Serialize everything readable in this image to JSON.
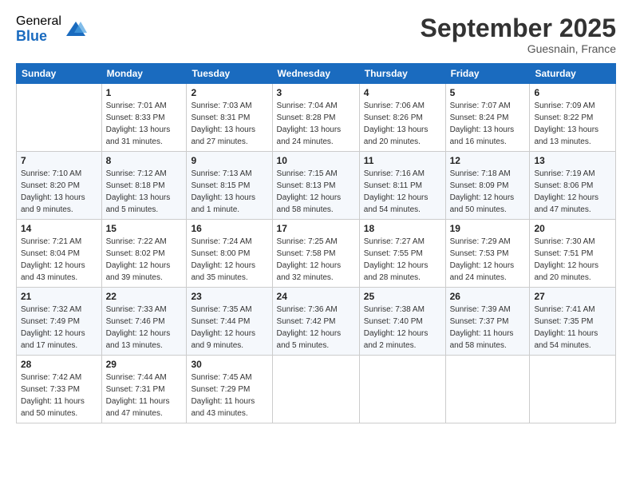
{
  "logo": {
    "general": "General",
    "blue": "Blue"
  },
  "title": "September 2025",
  "subtitle": "Guesnain, France",
  "days_header": [
    "Sunday",
    "Monday",
    "Tuesday",
    "Wednesday",
    "Thursday",
    "Friday",
    "Saturday"
  ],
  "weeks": [
    [
      {
        "day": "",
        "sunrise": "",
        "sunset": "",
        "daylight": ""
      },
      {
        "day": "1",
        "sunrise": "Sunrise: 7:01 AM",
        "sunset": "Sunset: 8:33 PM",
        "daylight": "Daylight: 13 hours and 31 minutes."
      },
      {
        "day": "2",
        "sunrise": "Sunrise: 7:03 AM",
        "sunset": "Sunset: 8:31 PM",
        "daylight": "Daylight: 13 hours and 27 minutes."
      },
      {
        "day": "3",
        "sunrise": "Sunrise: 7:04 AM",
        "sunset": "Sunset: 8:28 PM",
        "daylight": "Daylight: 13 hours and 24 minutes."
      },
      {
        "day": "4",
        "sunrise": "Sunrise: 7:06 AM",
        "sunset": "Sunset: 8:26 PM",
        "daylight": "Daylight: 13 hours and 20 minutes."
      },
      {
        "day": "5",
        "sunrise": "Sunrise: 7:07 AM",
        "sunset": "Sunset: 8:24 PM",
        "daylight": "Daylight: 13 hours and 16 minutes."
      },
      {
        "day": "6",
        "sunrise": "Sunrise: 7:09 AM",
        "sunset": "Sunset: 8:22 PM",
        "daylight": "Daylight: 13 hours and 13 minutes."
      }
    ],
    [
      {
        "day": "7",
        "sunrise": "Sunrise: 7:10 AM",
        "sunset": "Sunset: 8:20 PM",
        "daylight": "Daylight: 13 hours and 9 minutes."
      },
      {
        "day": "8",
        "sunrise": "Sunrise: 7:12 AM",
        "sunset": "Sunset: 8:18 PM",
        "daylight": "Daylight: 13 hours and 5 minutes."
      },
      {
        "day": "9",
        "sunrise": "Sunrise: 7:13 AM",
        "sunset": "Sunset: 8:15 PM",
        "daylight": "Daylight: 13 hours and 1 minute."
      },
      {
        "day": "10",
        "sunrise": "Sunrise: 7:15 AM",
        "sunset": "Sunset: 8:13 PM",
        "daylight": "Daylight: 12 hours and 58 minutes."
      },
      {
        "day": "11",
        "sunrise": "Sunrise: 7:16 AM",
        "sunset": "Sunset: 8:11 PM",
        "daylight": "Daylight: 12 hours and 54 minutes."
      },
      {
        "day": "12",
        "sunrise": "Sunrise: 7:18 AM",
        "sunset": "Sunset: 8:09 PM",
        "daylight": "Daylight: 12 hours and 50 minutes."
      },
      {
        "day": "13",
        "sunrise": "Sunrise: 7:19 AM",
        "sunset": "Sunset: 8:06 PM",
        "daylight": "Daylight: 12 hours and 47 minutes."
      }
    ],
    [
      {
        "day": "14",
        "sunrise": "Sunrise: 7:21 AM",
        "sunset": "Sunset: 8:04 PM",
        "daylight": "Daylight: 12 hours and 43 minutes."
      },
      {
        "day": "15",
        "sunrise": "Sunrise: 7:22 AM",
        "sunset": "Sunset: 8:02 PM",
        "daylight": "Daylight: 12 hours and 39 minutes."
      },
      {
        "day": "16",
        "sunrise": "Sunrise: 7:24 AM",
        "sunset": "Sunset: 8:00 PM",
        "daylight": "Daylight: 12 hours and 35 minutes."
      },
      {
        "day": "17",
        "sunrise": "Sunrise: 7:25 AM",
        "sunset": "Sunset: 7:58 PM",
        "daylight": "Daylight: 12 hours and 32 minutes."
      },
      {
        "day": "18",
        "sunrise": "Sunrise: 7:27 AM",
        "sunset": "Sunset: 7:55 PM",
        "daylight": "Daylight: 12 hours and 28 minutes."
      },
      {
        "day": "19",
        "sunrise": "Sunrise: 7:29 AM",
        "sunset": "Sunset: 7:53 PM",
        "daylight": "Daylight: 12 hours and 24 minutes."
      },
      {
        "day": "20",
        "sunrise": "Sunrise: 7:30 AM",
        "sunset": "Sunset: 7:51 PM",
        "daylight": "Daylight: 12 hours and 20 minutes."
      }
    ],
    [
      {
        "day": "21",
        "sunrise": "Sunrise: 7:32 AM",
        "sunset": "Sunset: 7:49 PM",
        "daylight": "Daylight: 12 hours and 17 minutes."
      },
      {
        "day": "22",
        "sunrise": "Sunrise: 7:33 AM",
        "sunset": "Sunset: 7:46 PM",
        "daylight": "Daylight: 12 hours and 13 minutes."
      },
      {
        "day": "23",
        "sunrise": "Sunrise: 7:35 AM",
        "sunset": "Sunset: 7:44 PM",
        "daylight": "Daylight: 12 hours and 9 minutes."
      },
      {
        "day": "24",
        "sunrise": "Sunrise: 7:36 AM",
        "sunset": "Sunset: 7:42 PM",
        "daylight": "Daylight: 12 hours and 5 minutes."
      },
      {
        "day": "25",
        "sunrise": "Sunrise: 7:38 AM",
        "sunset": "Sunset: 7:40 PM",
        "daylight": "Daylight: 12 hours and 2 minutes."
      },
      {
        "day": "26",
        "sunrise": "Sunrise: 7:39 AM",
        "sunset": "Sunset: 7:37 PM",
        "daylight": "Daylight: 11 hours and 58 minutes."
      },
      {
        "day": "27",
        "sunrise": "Sunrise: 7:41 AM",
        "sunset": "Sunset: 7:35 PM",
        "daylight": "Daylight: 11 hours and 54 minutes."
      }
    ],
    [
      {
        "day": "28",
        "sunrise": "Sunrise: 7:42 AM",
        "sunset": "Sunset: 7:33 PM",
        "daylight": "Daylight: 11 hours and 50 minutes."
      },
      {
        "day": "29",
        "sunrise": "Sunrise: 7:44 AM",
        "sunset": "Sunset: 7:31 PM",
        "daylight": "Daylight: 11 hours and 47 minutes."
      },
      {
        "day": "30",
        "sunrise": "Sunrise: 7:45 AM",
        "sunset": "Sunset: 7:29 PM",
        "daylight": "Daylight: 11 hours and 43 minutes."
      },
      {
        "day": "",
        "sunrise": "",
        "sunset": "",
        "daylight": ""
      },
      {
        "day": "",
        "sunrise": "",
        "sunset": "",
        "daylight": ""
      },
      {
        "day": "",
        "sunrise": "",
        "sunset": "",
        "daylight": ""
      },
      {
        "day": "",
        "sunrise": "",
        "sunset": "",
        "daylight": ""
      }
    ]
  ]
}
